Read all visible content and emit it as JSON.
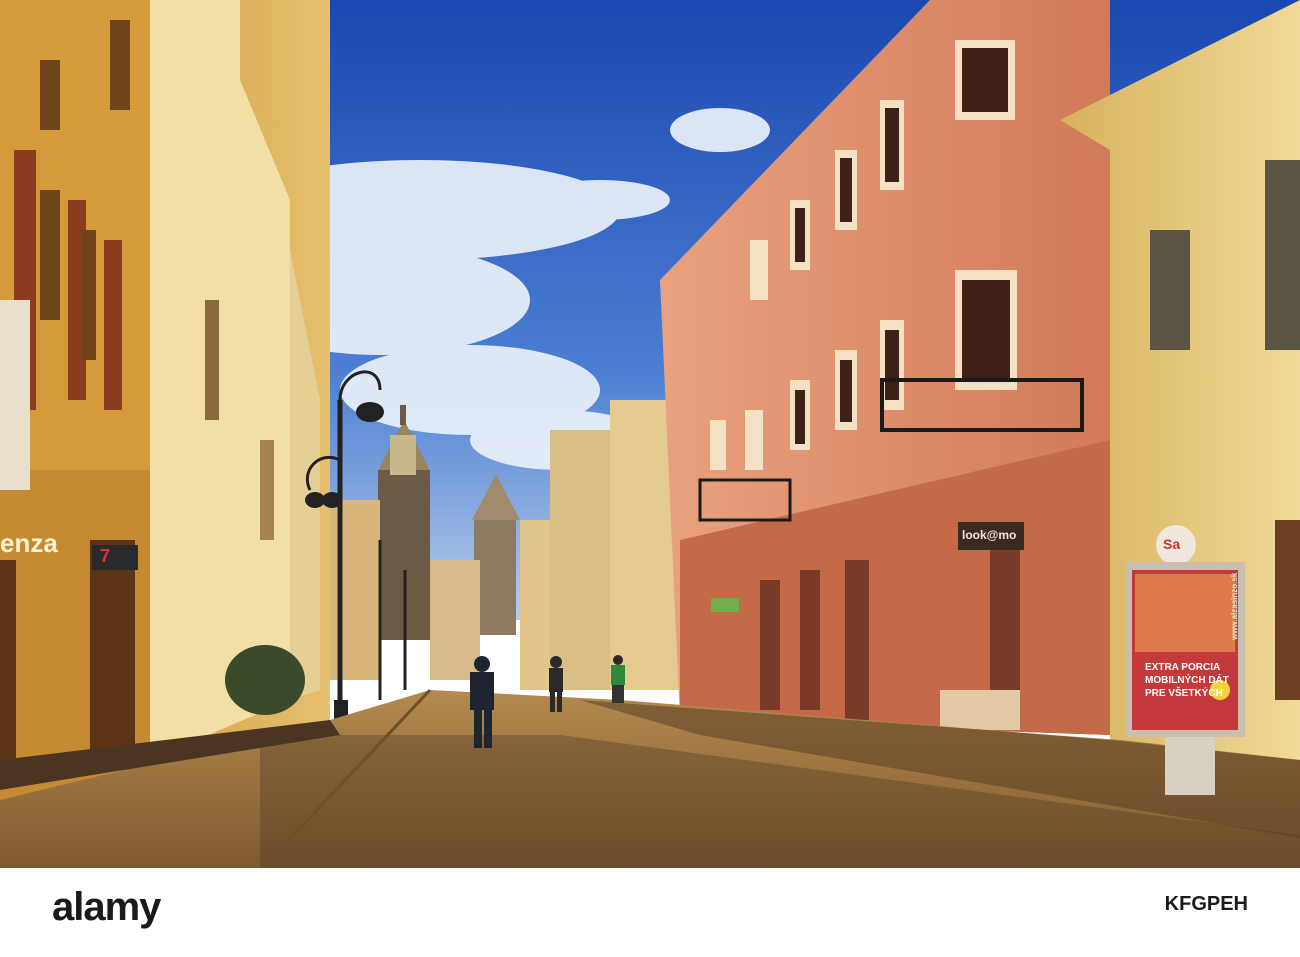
{
  "photo": {
    "subject": "pedestrian street with historic facades, street lamps and a distant cathedral spire",
    "colors": {
      "sky_top": "#1f4fb5",
      "sky_bottom": "#8fb3e6",
      "cloud": "#f2f5fb",
      "left_facade": "#d9a441",
      "left_facade_shadow": "#8a5a1c",
      "pink_building": "#d98a63",
      "pink_building_dark": "#a95a3d",
      "yellow_building_right": "#e0c274",
      "pavement": "#9a7340",
      "pavement_shadow": "#4b3522",
      "ground_bar": "#1a1a1a"
    },
    "signs": {
      "left_store": "enza",
      "left_shop": "7",
      "lookimo": "look@mo",
      "salon": "Sa",
      "billboard_line1": "EXTRA PORCIA",
      "billboard_line2": "MOBILNÝCH DÁT",
      "billboard_line3": "PRE VŠETKÝCH",
      "billboard_side": "www.alzasinzo.sk"
    }
  },
  "footer": {
    "brand": "alamy",
    "image_id": "KFGPEH"
  }
}
